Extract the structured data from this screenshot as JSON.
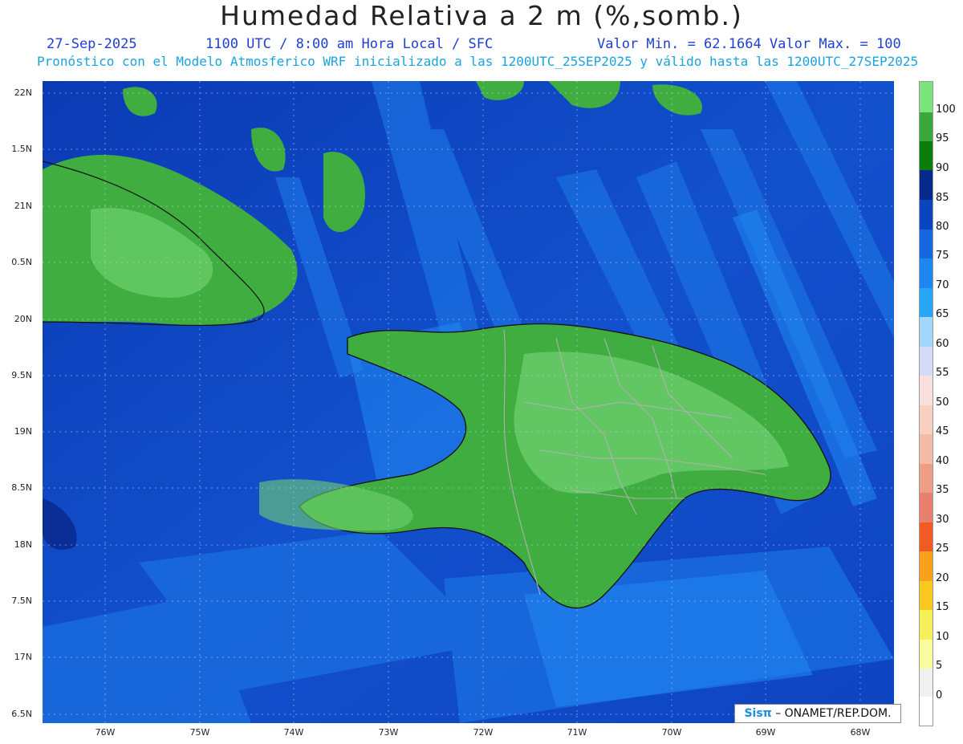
{
  "header": {
    "title": "Humedad Relativa a 2 m (%,somb.)",
    "date": "27-Sep-2025",
    "time": "1100 UTC / 8:00 am Hora Local / SFC",
    "range": "Valor Min. = 62.1664  Valor Max. = 100",
    "model": "Pronóstico con el Modelo Atmosferico WRF inicializado a las 1200UTC_25SEP2025 y válido hasta las  1200UTC_27SEP2025"
  },
  "map": {
    "lat_labels": [
      "22N",
      "1.5N",
      "21N",
      "0.5N",
      "20N",
      "9.5N",
      "19N",
      "8.5N",
      "18N",
      "7.5N",
      "17N",
      "6.5N"
    ],
    "lon_labels": [
      "76W",
      "75W",
      "74W",
      "73W",
      "72W",
      "71W",
      "70W",
      "69W",
      "68W"
    ],
    "colors": {
      "ocean_deep": "#0b3ab4",
      "ocean_mid": "#1452cf",
      "ocean_light": "#1a6fe0",
      "land_green": "#3fad3f",
      "land_dark": "#087a08",
      "land_light": "#6fd06f",
      "coast": "#111111",
      "border": "#b0b0b0"
    }
  },
  "colorbar": {
    "labels": [
      "100",
      "95",
      "90",
      "85",
      "80",
      "75",
      "70",
      "65",
      "60",
      "55",
      "50",
      "45",
      "40",
      "35",
      "30",
      "25",
      "20",
      "15",
      "10",
      "5",
      "0"
    ],
    "colors": [
      "#7be37b",
      "#3aa83a",
      "#0a7d0a",
      "#062a8a",
      "#0a44c0",
      "#1566df",
      "#1d86f0",
      "#27a6f7",
      "#47c2fb",
      "#a3d6fb",
      "#d3dcf6",
      "#fbe0e0",
      "#f9cfc2",
      "#f3bca4",
      "#ee9d87",
      "#e8806d",
      "#f15a24",
      "#f8a21b",
      "#f9c81d",
      "#f6ef5a",
      "#fbfb9f",
      "#f0f0f0"
    ]
  },
  "credit": {
    "logo": "Sisπ",
    "text": "– ONAMET/REP.DOM."
  }
}
